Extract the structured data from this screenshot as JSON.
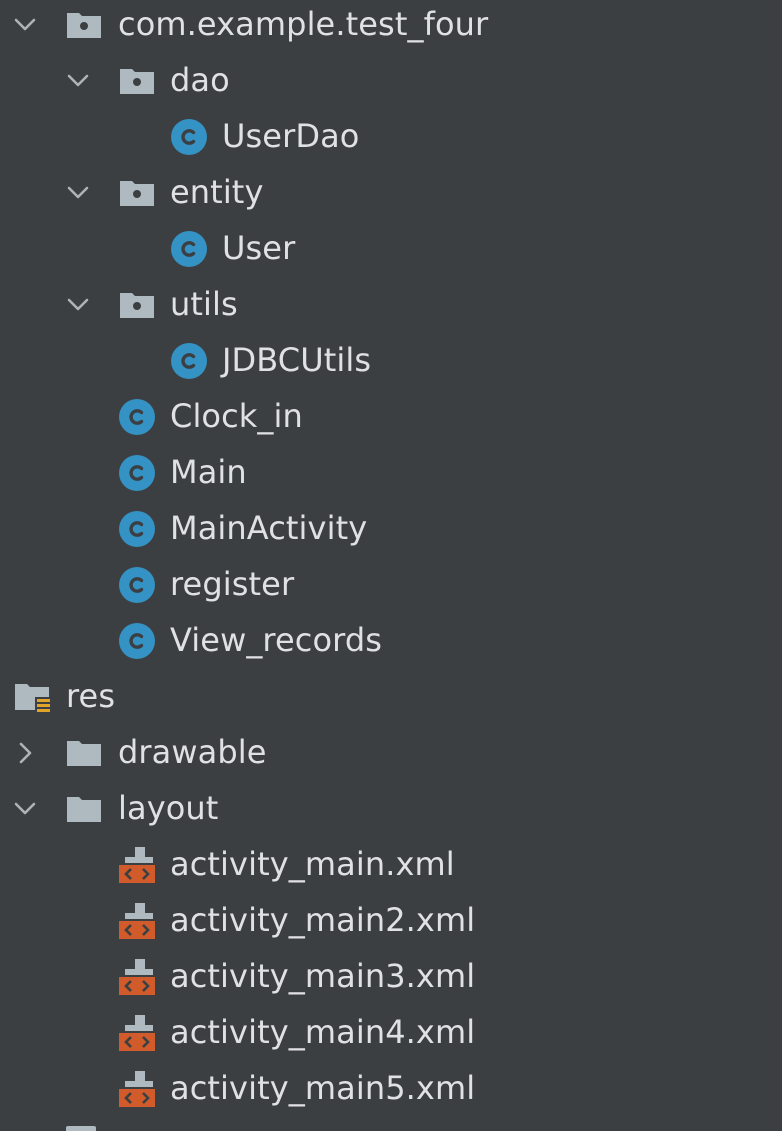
{
  "tree": {
    "items": [
      {
        "label": "com.example.test_four",
        "kind": "package",
        "expanded": true,
        "icon": "package-folder-icon"
      },
      {
        "label": "dao",
        "kind": "package",
        "expanded": true,
        "icon": "package-folder-icon"
      },
      {
        "label": "UserDao",
        "kind": "class",
        "icon": "java-class-icon"
      },
      {
        "label": "entity",
        "kind": "package",
        "expanded": true,
        "icon": "package-folder-icon"
      },
      {
        "label": "User",
        "kind": "class",
        "icon": "java-class-icon"
      },
      {
        "label": "utils",
        "kind": "package",
        "expanded": true,
        "icon": "package-folder-icon"
      },
      {
        "label": "JDBCUtils",
        "kind": "class",
        "icon": "java-class-icon"
      },
      {
        "label": "Clock_in",
        "kind": "class",
        "icon": "java-class-icon"
      },
      {
        "label": "Main",
        "kind": "class",
        "icon": "java-class-icon"
      },
      {
        "label": "MainActivity",
        "kind": "class",
        "icon": "java-class-icon"
      },
      {
        "label": "register",
        "kind": "class",
        "icon": "java-class-icon"
      },
      {
        "label": "View_records",
        "kind": "class",
        "icon": "java-class-icon"
      },
      {
        "label": "res",
        "kind": "resource-root",
        "icon": "resource-folder-icon"
      },
      {
        "label": "drawable",
        "kind": "folder",
        "expanded": false,
        "icon": "folder-icon"
      },
      {
        "label": "layout",
        "kind": "folder",
        "expanded": true,
        "icon": "folder-icon"
      },
      {
        "label": "activity_main.xml",
        "kind": "layout-file",
        "icon": "layout-xml-icon"
      },
      {
        "label": "activity_main2.xml",
        "kind": "layout-file",
        "icon": "layout-xml-icon"
      },
      {
        "label": "activity_main3.xml",
        "kind": "layout-file",
        "icon": "layout-xml-icon"
      },
      {
        "label": "activity_main4.xml",
        "kind": "layout-file",
        "icon": "layout-xml-icon"
      },
      {
        "label": "activity_main5.xml",
        "kind": "layout-file",
        "icon": "layout-xml-icon"
      }
    ]
  },
  "colors": {
    "background": "#3c3f41",
    "text": "#dfe1e5",
    "chevron": "#aeb3b8",
    "folder": "#aeb9c0",
    "class_icon": "#3592c4",
    "xml_icon_orange": "#d15b2a"
  }
}
